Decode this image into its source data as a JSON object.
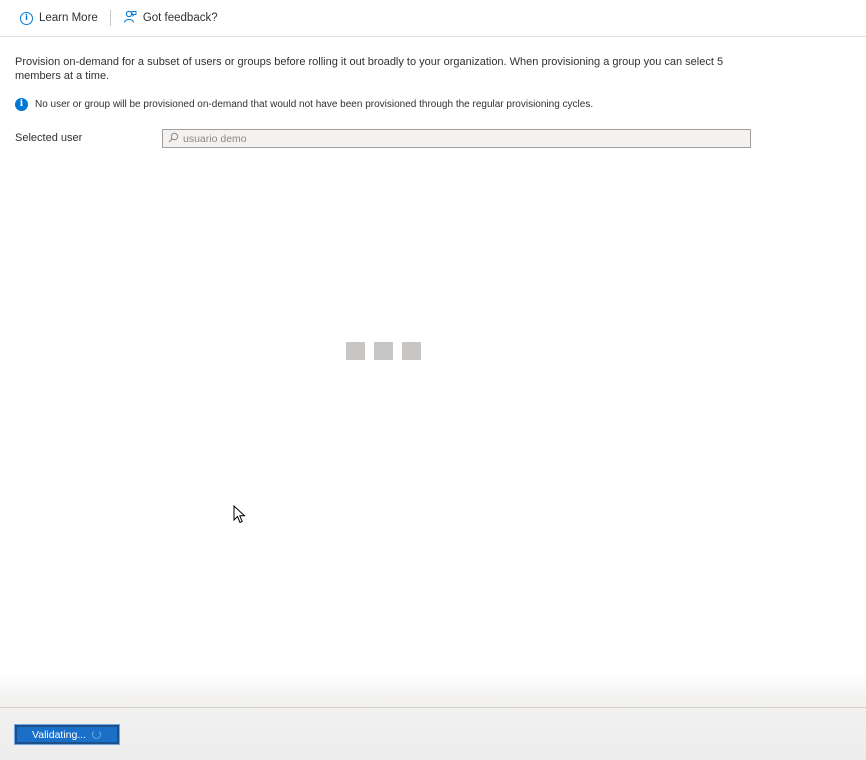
{
  "toolbar": {
    "learn_more_label": "Learn More",
    "feedback_label": "Got feedback?"
  },
  "main": {
    "description": "Provision on-demand for a subset of users or groups before rolling it out broadly to your organization. When provisioning a group you can select 5 members at a time.",
    "info_message": "No user or group will be provisioned on-demand that would not have been provisioned through the regular provisioning cycles.",
    "selected_user_label": "Selected user",
    "search": {
      "value": "usuario demo",
      "placeholder": ""
    }
  },
  "footer": {
    "validate_label": "Validating..."
  },
  "icons": {
    "learn_more": "info-icon",
    "feedback": "feedback-icon",
    "info": "info-icon",
    "search": "search-icon",
    "loading": "loading-icon",
    "cursor": "cursor-icon"
  },
  "colors": {
    "accent": "#0078d4",
    "button_bg": "#1a6fc9",
    "loader": "#c8c6c4"
  }
}
